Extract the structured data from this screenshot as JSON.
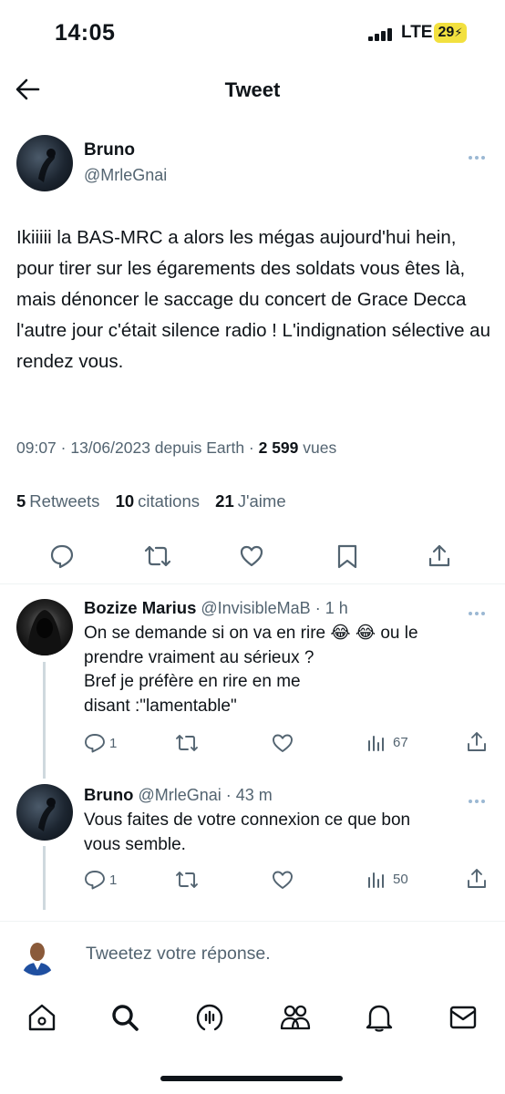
{
  "status_bar": {
    "time": "14:05",
    "network": "LTE",
    "battery": "29"
  },
  "header": {
    "title": "Tweet"
  },
  "tweet": {
    "author_name": "Bruno",
    "author_handle": "@MrleGnai",
    "text": "Ikiiiii la BAS-MRC a alors les mégas aujourd'hui hein, pour tirer sur les égarements des soldats vous êtes là, mais dénoncer le saccage du concert de Grace Decca l'autre jour c'était silence radio ! L'indignation sélective au rendez vous.",
    "meta_time": "09:07 · 13/06/2023 depuis Earth · ",
    "views_count": "2 599",
    "views_label": " vues",
    "retweets_count": "5",
    "retweets_label": "Retweets",
    "quotes_count": "10",
    "quotes_label": "citations",
    "likes_count": "21",
    "likes_label": "J'aime"
  },
  "replies": [
    {
      "author_name": "Bozize Marius",
      "author_handle": "@InvisibleMaB",
      "time": " · 1 h",
      "text_line1": "On se demande si on va en rire 😂 😂 ou le",
      "text_line2": "prendre vraiment au sérieux ?",
      "text_line3": "Bref je préfère en rire en me",
      "text_line4": "disant :\"lamentable\"",
      "reply_count": "1",
      "views_count": "67"
    },
    {
      "author_name": "Bruno",
      "author_handle": "@MrleGnai",
      "time": " · 43 m",
      "text_line1": "Vous faites de votre connexion ce que bon",
      "text_line2": "vous semble.",
      "reply_count": "1",
      "views_count": "50"
    }
  ],
  "compose": {
    "placeholder": "Tweetez votre réponse."
  },
  "icons": {
    "back": "arrow-left-icon",
    "reply": "comment-icon",
    "retweet": "retweet-icon",
    "like": "heart-icon",
    "bookmark": "bookmark-icon",
    "share": "share-icon",
    "views": "bar-chart-icon",
    "nav": [
      "home-icon",
      "search-icon",
      "spaces-icon",
      "communities-icon",
      "bell-icon",
      "mail-icon"
    ]
  },
  "colors": {
    "text": "#0f1419",
    "muted": "#536471",
    "battery": "#f2e03f",
    "divider": "#eff3f4"
  }
}
